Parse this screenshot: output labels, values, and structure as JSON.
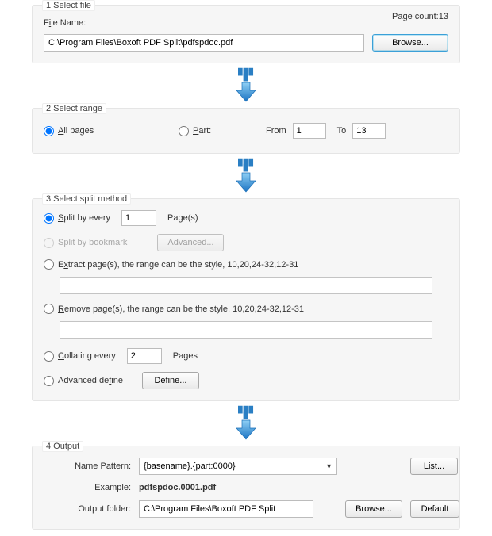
{
  "step1": {
    "title": "1 Select file",
    "fileLabelPre": "F",
    "fileLabelUnder": "i",
    "fileLabelPost": "le Name:",
    "path": "C:\\Program Files\\Boxoft PDF Split\\pdfspdoc.pdf",
    "browse": "Browse...",
    "pageCountLabel": "Page count:",
    "pageCountValue": "13"
  },
  "step2": {
    "title": "2 Select range",
    "allPre": "",
    "allUnder": "A",
    "allPost": "ll pages",
    "partPre": "",
    "partUnder": "P",
    "partPost": "art:",
    "fromLabel": "From",
    "fromValue": "1",
    "toLabel": "To",
    "toValue": "13"
  },
  "step3": {
    "title": "3 Select split method",
    "splitEveryPre": "",
    "splitEveryUnder": "S",
    "splitEveryPost": "plit by every",
    "splitEveryValue": "1",
    "splitEveryUnit": "Page(s)",
    "bookmarkLabel": "Split by bookmark",
    "advancedBtn": "Advanced...",
    "extractPre": "E",
    "extractUnder": "x",
    "extractPost": "tract page(s), the range can be the style, 10,20,24-32,12-31",
    "removePre": "",
    "removeUnder": "R",
    "removePost": "emove page(s), the range can be the style, 10,20,24-32,12-31",
    "collatingPre": "",
    "collatingUnder": "C",
    "collatingPost": "ollating every",
    "collatingValue": "2",
    "collatingUnit": "Pages",
    "advDefinePre": "Advanced de",
    "advDefineUnder": "f",
    "advDefinePost": "ine",
    "defineBtn": "Define..."
  },
  "step4": {
    "title": "4 Output",
    "namePatternLabel": "Name Pattern:",
    "namePatternValue": "{basename}.{part:0000}",
    "listBtn": "List...",
    "exampleLabel": "Example:",
    "exampleValue": "pdfspdoc.0001.pdf",
    "outputFolderLabel": "Output folder:",
    "outputFolderValue": "C:\\Program Files\\Boxoft PDF Split",
    "browseBtn": "Browse...",
    "defaultBtn": "Default"
  }
}
